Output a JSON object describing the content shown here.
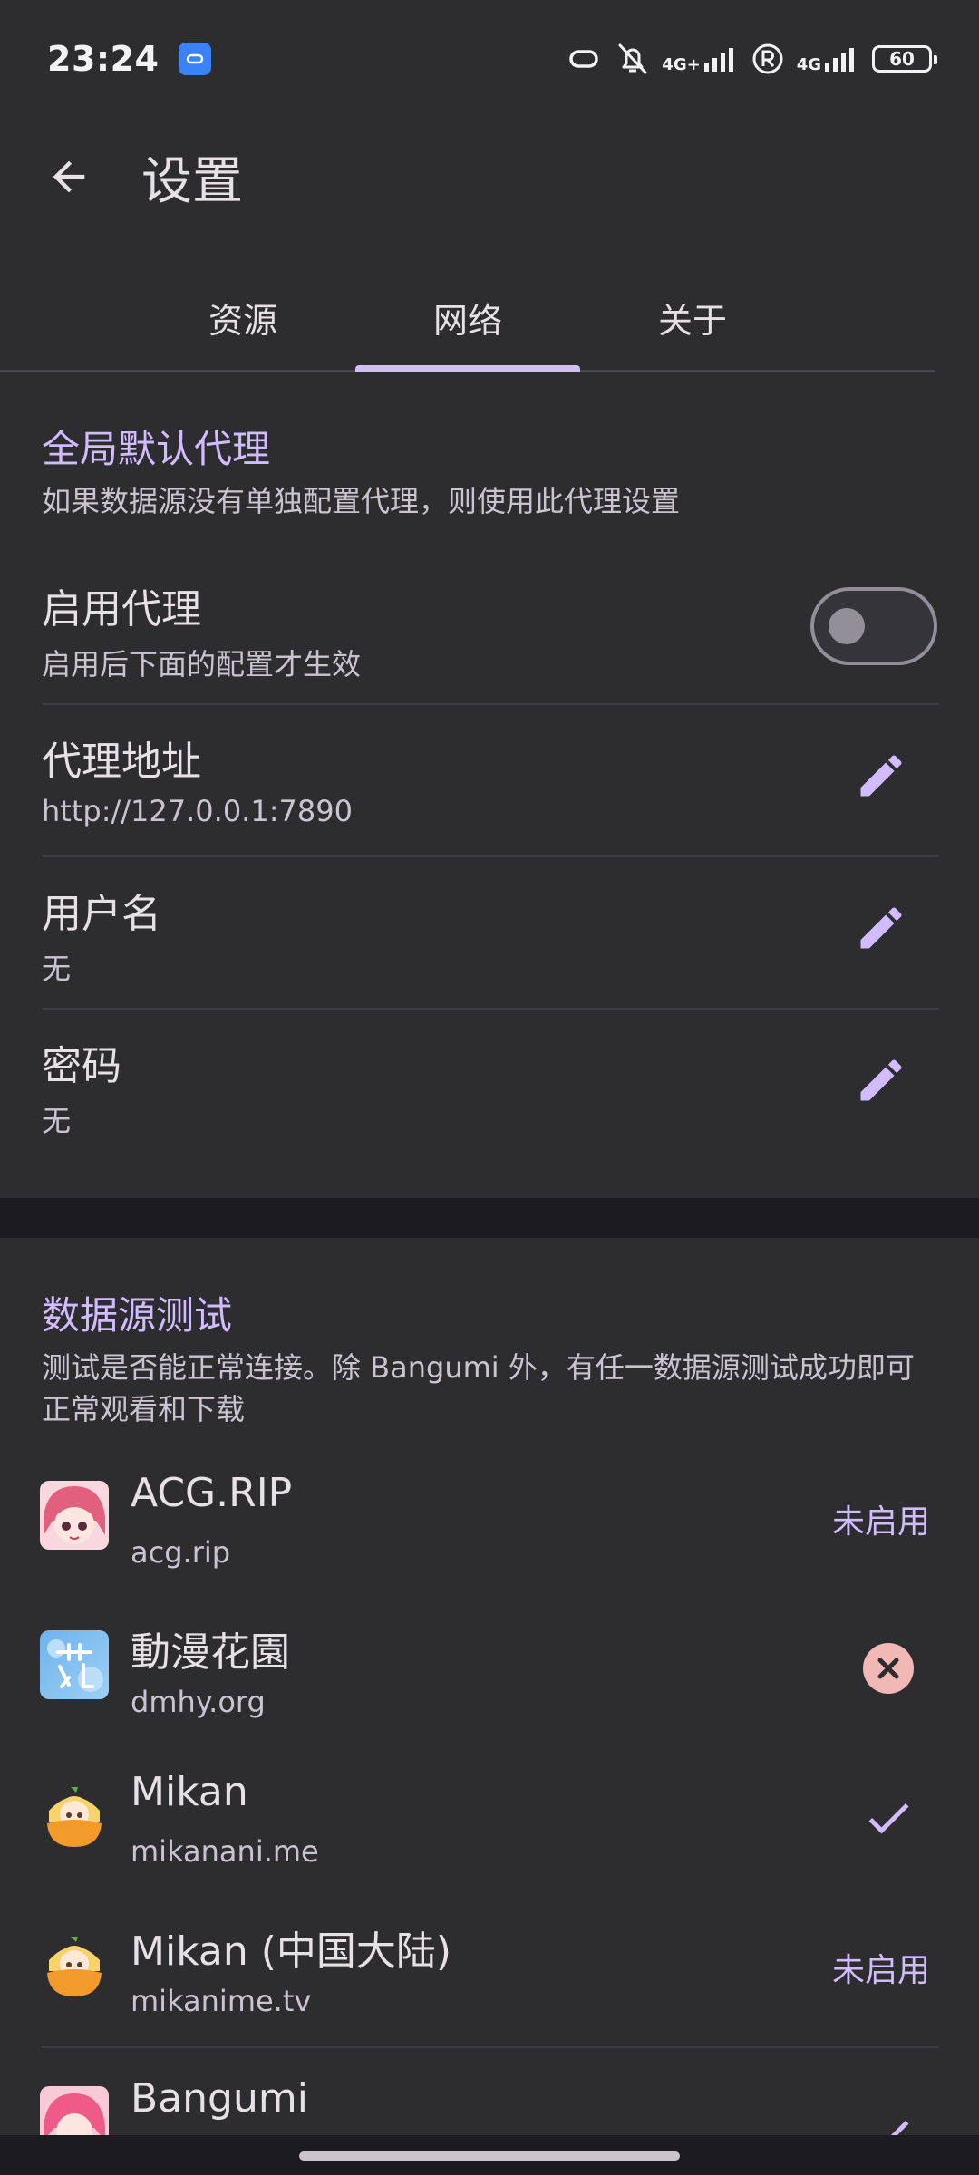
{
  "status_bar": {
    "time": "23:24",
    "net_label_1": "4G+",
    "net_label_2": "4G",
    "battery": "60",
    "icons": [
      "app-badge-icon",
      "link-icon",
      "bell-off-icon",
      "signal-icon",
      "registered-icon",
      "signal-icon",
      "battery-icon"
    ]
  },
  "app_bar": {
    "title": "设置",
    "back_icon": "arrow-back-icon"
  },
  "tabs": [
    {
      "label": "资源",
      "selected": false
    },
    {
      "label": "网络",
      "selected": true
    },
    {
      "label": "关于",
      "selected": false
    }
  ],
  "proxy_section": {
    "title": "全局默认代理",
    "description": "如果数据源没有单独配置代理，则使用此代理设置",
    "enable": {
      "title": "启用代理",
      "subtitle": "启用后下面的配置才生效",
      "enabled": false
    },
    "address": {
      "title": "代理地址",
      "value": "http://127.0.0.1:7890"
    },
    "username": {
      "title": "用户名",
      "value": "无"
    },
    "password": {
      "title": "密码",
      "value": "无"
    }
  },
  "test_section": {
    "title": "数据源测试",
    "description": "测试是否能正常连接。除 Bangumi 外，有任一数据源测试成功即可正常观看和下载",
    "sources": [
      {
        "name": "ACG.RIP",
        "url": "acg.rip",
        "status": "未启用",
        "status_icon": null,
        "avatar_icon": "acgrip-logo-icon"
      },
      {
        "name": "動漫花園",
        "url": "dmhy.org",
        "status": null,
        "status_icon": "error-circle-icon",
        "avatar_icon": "dmhy-logo-icon"
      },
      {
        "name": "Mikan",
        "url": "mikanani.me",
        "status": null,
        "status_icon": "check-icon",
        "avatar_icon": "mikan-logo-icon"
      },
      {
        "name": "Mikan (中国大陆)",
        "url": "mikanime.tv",
        "status": "未启用",
        "status_icon": null,
        "avatar_icon": "mikan-logo-icon"
      },
      {
        "name": "Bangumi",
        "url": "",
        "status": null,
        "status_icon": "check-icon",
        "avatar_icon": "bangumi-logo-icon"
      }
    ]
  },
  "colors": {
    "background": "#2d2d30",
    "accent": "#d0bcff",
    "error_bg": "#f2b8b5",
    "text_primary": "#e6e1e5",
    "text_secondary": "#cac4d0"
  }
}
